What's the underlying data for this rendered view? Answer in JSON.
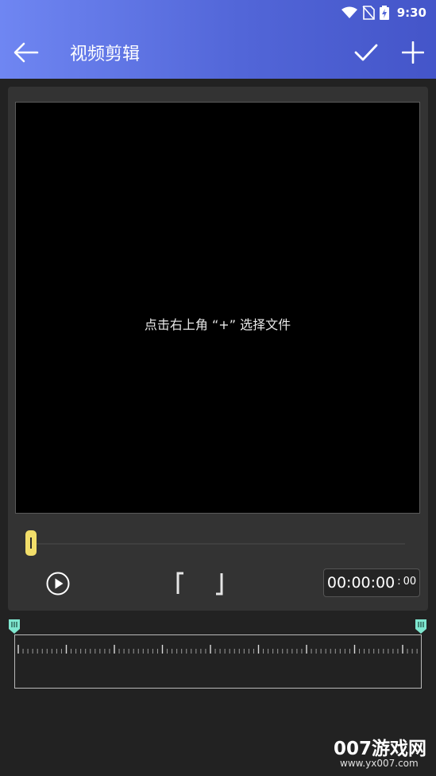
{
  "status_bar": {
    "time": "9:30",
    "icons": [
      "wifi-icon",
      "no-sim-icon",
      "battery-charging-icon"
    ]
  },
  "app_bar": {
    "back_icon": "arrow-left-icon",
    "title": "视频剪辑",
    "confirm_icon": "check-icon",
    "add_icon": "plus-icon",
    "colors": {
      "gradient_start": "#6f86f2",
      "gradient_end": "#4455c9"
    }
  },
  "preview": {
    "hint": "点击右上角 “+” 选择文件"
  },
  "player": {
    "play_icon": "play-circle-icon",
    "trim_start_icon": "bracket-left-icon",
    "trim_end_icon": "bracket-right-icon",
    "progress": 0,
    "time_main": "00:00:00",
    "time_frames": "00",
    "handle_color": "#f2de6a"
  },
  "timeline": {
    "start_marker_icon": "range-start-marker-icon",
    "end_marker_icon": "range-end-marker-icon",
    "marker_color": "#7fe6cf"
  },
  "watermark": {
    "main": "007游戏网",
    "sub": "www.yx007.com"
  }
}
